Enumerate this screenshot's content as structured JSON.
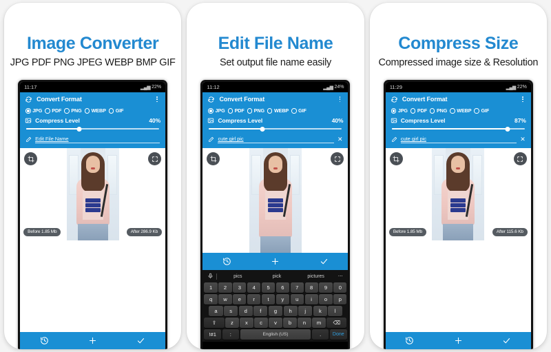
{
  "background_color": "#f4f4f4",
  "accent_color": "#1a8fd4",
  "title_color": "#2389d0",
  "panels": [
    {
      "title": "Image Converter",
      "subtitle": "JPG PDF PNG JPEG WEBP BMP GIF",
      "status": {
        "time": "11:17",
        "signal": "▂▄▆",
        "battery": "22%"
      },
      "appbar": {
        "title": "Convert Format",
        "icon": "convert-icon",
        "menu_icon": "overflow-menu-icon"
      },
      "formats": [
        {
          "label": "JPG",
          "selected": true
        },
        {
          "label": "PDF",
          "selected": false
        },
        {
          "label": "PNG",
          "selected": false
        },
        {
          "label": "WEBP",
          "selected": false
        },
        {
          "label": "GIF",
          "selected": false
        }
      ],
      "compress": {
        "label": "Compress Level",
        "value": "40%",
        "percent": 40
      },
      "filename": {
        "text": "Edit File Name",
        "is_placeholder": true,
        "show_clear": false
      },
      "photo": {
        "crop_icon": "crop-icon",
        "expand_icon": "expand-icon",
        "before": "Before  1.85 Mb",
        "after": "After  286.9 Kb"
      },
      "bottombar": [
        {
          "icon": "history-icon"
        },
        {
          "icon": "add-icon"
        },
        {
          "icon": "check-icon"
        }
      ],
      "keyboard": null
    },
    {
      "title": "Edit File Name",
      "subtitle": "Set output file name easily",
      "status": {
        "time": "11:12",
        "signal": "▂▄▆",
        "battery": "24%"
      },
      "appbar": {
        "title": "Convert Format",
        "icon": "convert-icon",
        "menu_icon": "overflow-menu-icon"
      },
      "formats": [
        {
          "label": "JPG",
          "selected": true
        },
        {
          "label": "PDF",
          "selected": false
        },
        {
          "label": "PNG",
          "selected": false
        },
        {
          "label": "WEBP",
          "selected": false
        },
        {
          "label": "GIF",
          "selected": false
        }
      ],
      "compress": {
        "label": "Compress Level",
        "value": "40%",
        "percent": 40
      },
      "filename": {
        "text": "cute girl pic",
        "is_placeholder": false,
        "show_clear": true
      },
      "photo": {
        "crop_icon": "crop-icon",
        "expand_icon": "expand-icon",
        "before": "",
        "after": ""
      },
      "bottombar": [
        {
          "icon": "history-icon"
        },
        {
          "icon": "add-icon"
        },
        {
          "icon": "check-icon"
        }
      ],
      "keyboard": {
        "suggestions": [
          "pics",
          "pick",
          "pictures"
        ],
        "mic_icon": "mic-icon",
        "more_icon": "more-dots-icon",
        "numbers": [
          "1",
          "2",
          "3",
          "4",
          "5",
          "6",
          "7",
          "8",
          "9",
          "0"
        ],
        "row1": [
          "q",
          "w",
          "e",
          "r",
          "t",
          "y",
          "u",
          "i",
          "o",
          "p"
        ],
        "row2": [
          "a",
          "s",
          "d",
          "f",
          "g",
          "h",
          "j",
          "k",
          "l"
        ],
        "row3_shift": "⇧",
        "row3": [
          "z",
          "x",
          "c",
          "v",
          "b",
          "n",
          "m"
        ],
        "row3_backspace": "⌫",
        "symbols_key": "!#1",
        "emoji_key": ":",
        "space_label": "English (US)",
        "period_key": ".",
        "done_key": "Done"
      }
    },
    {
      "title": "Compress Size",
      "subtitle": "Compressed image size & Resolution",
      "status": {
        "time": "11:29",
        "signal": "▂▄▆",
        "battery": "22%"
      },
      "appbar": {
        "title": "Convert Format",
        "icon": "convert-icon",
        "menu_icon": "overflow-menu-icon"
      },
      "formats": [
        {
          "label": "JPG",
          "selected": true
        },
        {
          "label": "PDF",
          "selected": false
        },
        {
          "label": "PNG",
          "selected": false
        },
        {
          "label": "WEBP",
          "selected": false
        },
        {
          "label": "GIF",
          "selected": false
        }
      ],
      "compress": {
        "label": "Compress Level",
        "value": "87%",
        "percent": 87
      },
      "filename": {
        "text": "cute girl pic",
        "is_placeholder": false,
        "show_clear": true
      },
      "photo": {
        "crop_icon": "crop-icon",
        "expand_icon": "expand-icon",
        "before": "Before  1.85 Mb",
        "after": "After  115.6 Kb"
      },
      "bottombar": [
        {
          "icon": "history-icon"
        },
        {
          "icon": "add-icon"
        },
        {
          "icon": "check-icon"
        }
      ],
      "keyboard": null
    }
  ]
}
